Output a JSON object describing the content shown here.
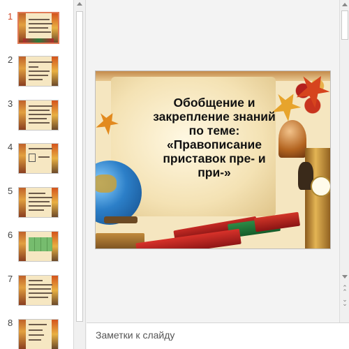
{
  "thumbnails": [
    {
      "number": "1",
      "selected": true
    },
    {
      "number": "2",
      "selected": false
    },
    {
      "number": "3",
      "selected": false
    },
    {
      "number": "4",
      "selected": false
    },
    {
      "number": "5",
      "selected": false
    },
    {
      "number": "6",
      "selected": false
    },
    {
      "number": "7",
      "selected": false
    },
    {
      "number": "8",
      "selected": false
    }
  ],
  "slide": {
    "title": "Обобщение и\nзакрепление знаний\nпо теме:\n«Правописание\nприставок пре- и\nпри-»"
  },
  "notes": {
    "placeholder": "Заметки к слайду"
  },
  "colors": {
    "selected_thumbnail_border": "#e07a56",
    "selected_number": "#d24726",
    "slide_background": "#f5e6c0"
  }
}
